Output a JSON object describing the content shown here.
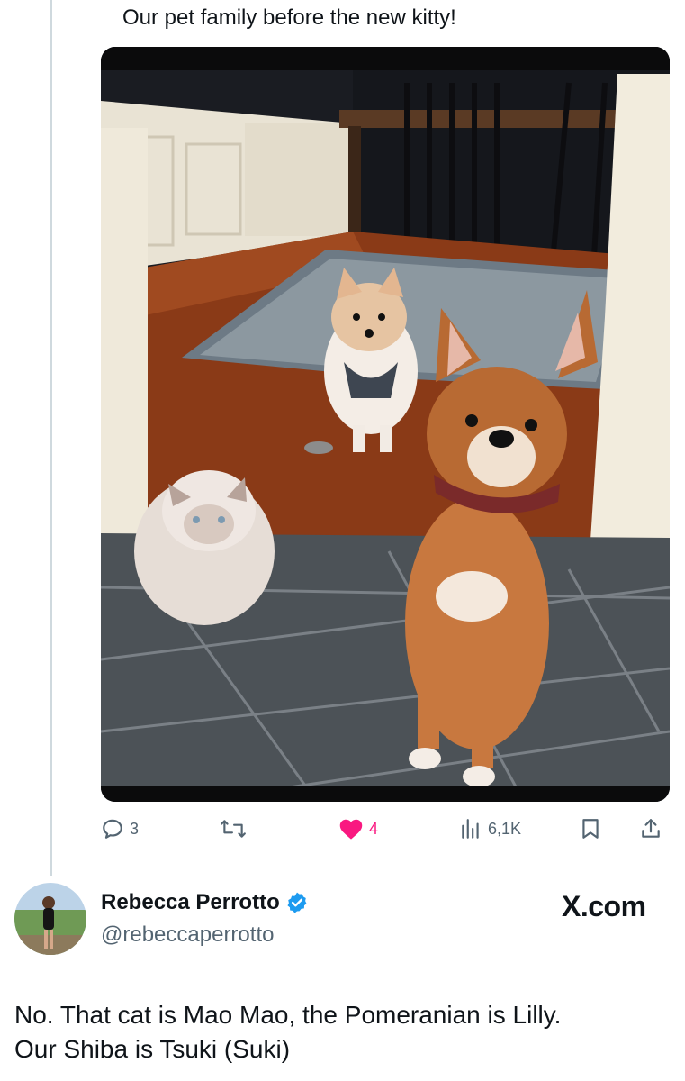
{
  "post": {
    "caption": "Our pet family before the new kitty!",
    "image_alt": "Cat, Pomeranian and Shiba Inu posing on a tiled floor in a doorway",
    "metrics": {
      "replies": "3",
      "likes": "4",
      "views": "6,1K"
    }
  },
  "icons": [
    "reply-icon",
    "repost-icon",
    "like-icon",
    "views-icon",
    "bookmark-icon",
    "share-icon",
    "verified-icon"
  ],
  "reply": {
    "display_name": "Rebecca Perrotto",
    "handle": "@rebeccaperrotto",
    "brand": "X.com",
    "text_lines": [
      "No. That cat is Mao Mao, the Pomeranian is Lilly.",
      "Our Shiba is Tsuki (Suki)"
    ]
  },
  "colors": {
    "like": "#f91880",
    "verified": "#1d9bf0",
    "muted": "#536471",
    "text": "#0f1419"
  }
}
